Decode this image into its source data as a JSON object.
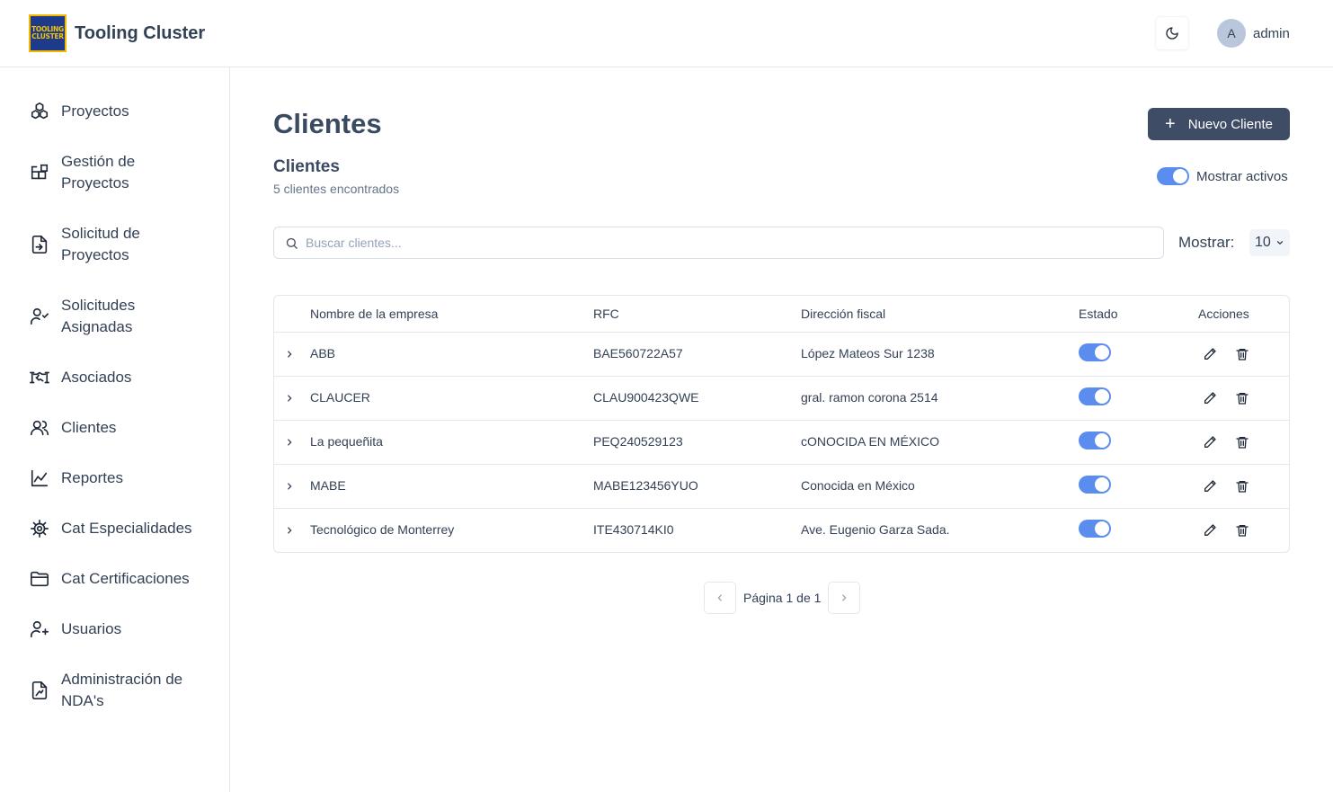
{
  "app": {
    "logo_text_line1": "TOOLING",
    "logo_text_line2": "CLUSTER",
    "title": "Tooling Cluster"
  },
  "header": {
    "theme_icon": "moon-icon",
    "user_initial": "A",
    "user_name": "admin"
  },
  "sidebar": {
    "items": [
      {
        "label": "Proyectos",
        "icon": "boxes-icon"
      },
      {
        "label": "Gestión de Proyectos",
        "icon": "blocks-icon"
      },
      {
        "label": "Solicitud de Proyectos",
        "icon": "file-input-icon"
      },
      {
        "label": "Solicitudes Asignadas",
        "icon": "user-check-icon"
      },
      {
        "label": "Asociados",
        "icon": "handshake-icon"
      },
      {
        "label": "Clientes",
        "icon": "users-icon"
      },
      {
        "label": "Reportes",
        "icon": "line-chart-icon"
      },
      {
        "label": "Cat Especialidades",
        "icon": "cog-icon"
      },
      {
        "label": "Cat Certificaciones",
        "icon": "folder-icon"
      },
      {
        "label": "Usuarios",
        "icon": "user-plus-icon"
      },
      {
        "label": "Administración de NDA's",
        "icon": "file-signature-icon"
      }
    ]
  },
  "main": {
    "page_title": "Clientes",
    "new_button_label": "Nuevo Cliente",
    "section_title": "Clientes",
    "count_text": "5 clientes encontrados",
    "toggle_label": "Mostrar activos",
    "search_placeholder": "Buscar clientes...",
    "show_label": "Mostrar:",
    "show_value": "10"
  },
  "table": {
    "columns": [
      "Nombre de la empresa",
      "RFC",
      "Dirección fiscal",
      "Estado",
      "Acciones"
    ],
    "rows": [
      {
        "name": "ABB",
        "rfc": "BAE560722A57",
        "address": "López Mateos Sur 1238",
        "active": true
      },
      {
        "name": "CLAUCER",
        "rfc": "CLAU900423QWE",
        "address": "gral. ramon corona 2514",
        "active": true
      },
      {
        "name": "La pequeñita",
        "rfc": "PEQ240529123",
        "address": "cONOCIDA EN MÉXICO",
        "active": true
      },
      {
        "name": "MABE",
        "rfc": "MABE123456YUO",
        "address": "Conocida en México",
        "active": true
      },
      {
        "name": "Tecnológico de Monterrey",
        "rfc": "ITE430714KI0",
        "address": "Ave. Eugenio Garza Sada.",
        "active": true
      }
    ]
  },
  "pagination": {
    "text": "Página 1 de 1"
  },
  "colors": {
    "primary": "#3f4c66",
    "toggle_on": "#5b8def",
    "border": "#e5e7eb"
  }
}
